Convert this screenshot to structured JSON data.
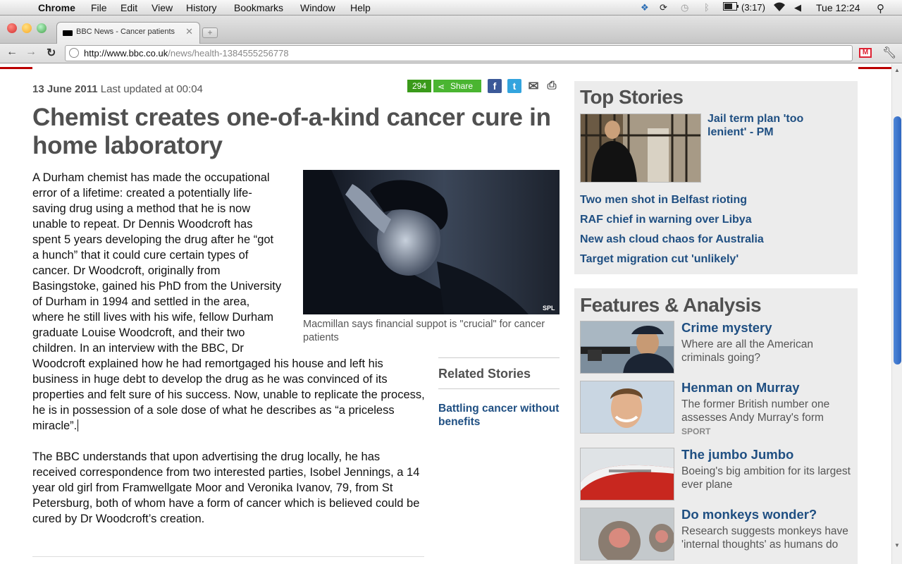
{
  "menubar": {
    "app_name": "Chrome",
    "menus": [
      "File",
      "Edit",
      "View",
      "History",
      "Bookmarks",
      "Window",
      "Help"
    ],
    "battery": "(3:17)",
    "clock": "Tue 12:24"
  },
  "browser": {
    "tab_title": "BBC News - Cancer patients",
    "url_host": "http://www.bbc.co.uk",
    "url_path": "/news/health-1384555256778",
    "gmail_label": "M",
    "new_tab_label": "+"
  },
  "article": {
    "date": "13 June 2011",
    "updated": "Last updated at 00:04",
    "share_count": "294",
    "share_label": "Share",
    "headline": "Chemist creates one-of-a-kind cancer cure in home laboratory",
    "paragraph_1": "A Durham chemist has made the occupational error of a lifetime: created a potentially life-saving drug using a method that he is now unable to repeat.  Dr Dennis Woodcroft has spent 5 years developing the drug after he “got a hunch” that it could cure certain types of cancer.  Dr Woodcroft, originally from Basingstoke, gained his PhD from the University of Durham in 1994 and settled in the area, where he still lives with his wife, fellow Durham graduate Louise Woodcroft, and their two children.  In an interview with the BBC, Dr Woodcroft explained how he had remortgaged his house and left his business in huge debt to develop the drug as he was convinced of its properties and felt sure of his success.  Now, unable to replicate the process, he is in possession of a sole dose of what he describes as “a priceless miracle”.",
    "paragraph_2": "The BBC understands that upon advertising the drug locally, he has received correspondence from two interested parties, Isobel Jennings, a 14 year old girl from Framwellgate Moor and Veronika Ivanov, 79, from St Petersburg, both of whom have a form of cancer which is believed could be cured by Dr Woodcroft’s creation.",
    "photo_credit": "SPL",
    "photo_caption": "Macmillan says financial suppot is \"crucial\" for cancer patients",
    "related_heading": "Related Stories",
    "related_link": "Battling cancer without benefits"
  },
  "top_stories": {
    "heading": "Top Stories",
    "lead": "Jail term plan 'too lenient' - PM",
    "links": [
      "Two men shot in Belfast rioting",
      "RAF chief in warning over Libya",
      "New ash cloud chaos for Australia",
      "Target migration cut 'unlikely'"
    ]
  },
  "features": {
    "heading": "Features & Analysis",
    "items": [
      {
        "title": "Crime mystery",
        "desc": "Where are all the American criminals going?",
        "tag": ""
      },
      {
        "title": "Henman on Murray",
        "desc": "The former British number one assesses Andy Murray's form",
        "tag": "SPORT"
      },
      {
        "title": "The jumbo Jumbo",
        "desc": "Boeing's big ambition for its largest ever plane",
        "tag": ""
      },
      {
        "title": "Do monkeys wonder?",
        "desc": "Research suggests monkeys have 'internal thoughts' as humans do",
        "tag": ""
      }
    ]
  },
  "colors": {
    "link": "#1f4f82",
    "headline": "#505050",
    "bbc_red": "#bb0000",
    "share_green": "#4ab531"
  }
}
